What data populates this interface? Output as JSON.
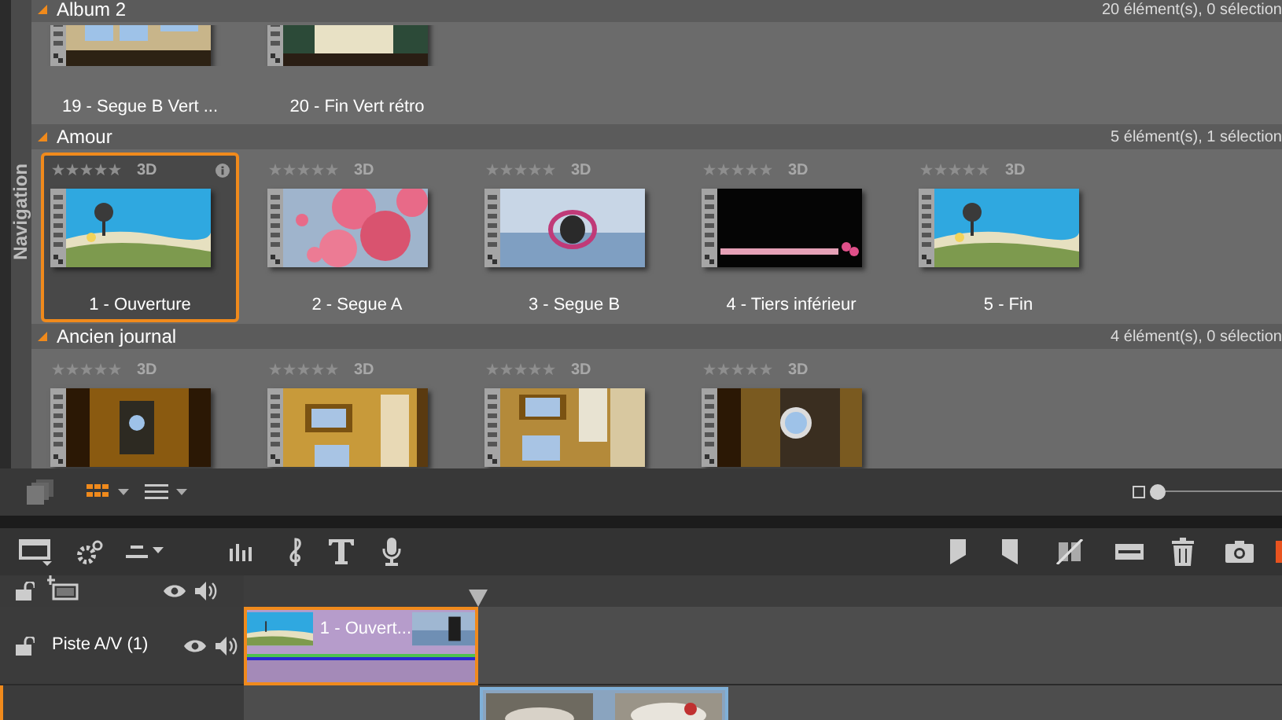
{
  "navigation_panel": {
    "title": "Navigation"
  },
  "sections": [
    {
      "title": "Album 2",
      "count": "20 élément(s), 0 sélection",
      "expanded": true,
      "items": [
        {
          "label": "19 - Segue B Vert ...",
          "selected": false
        },
        {
          "label": "20 - Fin Vert rétro",
          "selected": false
        }
      ]
    },
    {
      "title": "Amour",
      "count": "5 élément(s), 1 sélection",
      "expanded": true,
      "items": [
        {
          "stars": 0,
          "badge": "3D",
          "label": "1 - Ouverture",
          "selected": true
        },
        {
          "stars": 0,
          "badge": "3D",
          "label": "2 - Segue A",
          "selected": false
        },
        {
          "stars": 0,
          "badge": "3D",
          "label": "3 - Segue B",
          "selected": false
        },
        {
          "stars": 0,
          "badge": "3D",
          "label": "4 - Tiers inférieur",
          "selected": false
        },
        {
          "stars": 0,
          "badge": "3D",
          "label": "5 - Fin",
          "selected": false
        }
      ]
    },
    {
      "title": "Ancien journal",
      "count": "4 élément(s), 0 sélection",
      "expanded": true,
      "items": [
        {
          "stars": 0,
          "badge": "3D",
          "selected": false
        },
        {
          "stars": 0,
          "badge": "3D",
          "selected": false
        },
        {
          "stars": 0,
          "badge": "3D",
          "selected": false
        },
        {
          "stars": 0,
          "badge": "3D",
          "selected": false
        }
      ]
    }
  ],
  "library_toolbar": {
    "view_modes": [
      {
        "kind": "grid",
        "selected": true
      },
      {
        "kind": "list",
        "selected": false
      }
    ],
    "zoom": {
      "level": 0
    }
  },
  "timeline": {
    "tracks": [
      {
        "name": "Piste A/V (1)",
        "selected": false,
        "clips": [
          {
            "label": "1 - Ouvert...",
            "selected": true
          }
        ]
      },
      {
        "selected": true,
        "clips": [
          {
            "selected": false
          }
        ]
      }
    ]
  }
}
